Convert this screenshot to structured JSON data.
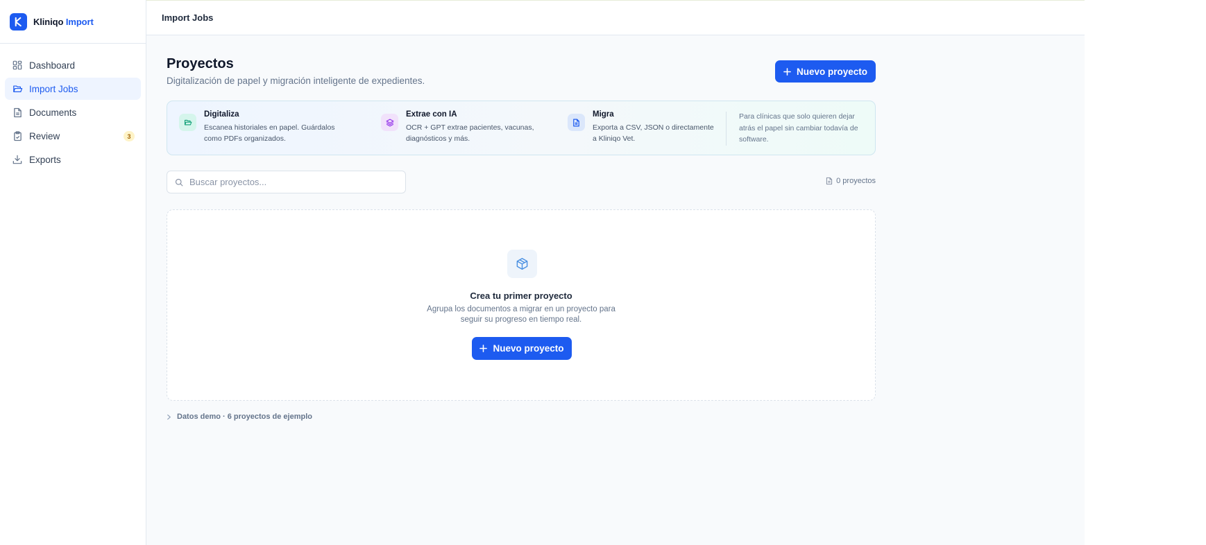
{
  "brand": {
    "name": "Kliniqo",
    "accent": "Import"
  },
  "sidebar": {
    "items": [
      {
        "label": "Dashboard",
        "icon": "dashboard-icon"
      },
      {
        "label": "Import Jobs",
        "icon": "folder-open-icon",
        "active": true
      },
      {
        "label": "Documents",
        "icon": "document-icon"
      },
      {
        "label": "Review",
        "icon": "clipboard-icon",
        "badge": "3"
      },
      {
        "label": "Exports",
        "icon": "download-icon"
      }
    ]
  },
  "topbar": {
    "title": "Import Jobs"
  },
  "header": {
    "title": "Proyectos",
    "subtitle": "Digitalización de papel y migración inteligente de expedientes.",
    "new_project_label": "Nuevo proyecto"
  },
  "features": {
    "items": [
      {
        "title": "Digitaliza",
        "desc": "Escanea historiales en papel. Guárdalos como PDFs organizados.",
        "icon": "folder-open-icon"
      },
      {
        "title": "Extrae con IA",
        "desc": "OCR + GPT extrae pacientes, vacunas, diagnósticos y más.",
        "icon": "layers-icon"
      },
      {
        "title": "Migra",
        "desc": "Exporta a CSV, JSON o directamente a Kliniqo Vet.",
        "icon": "file-text-icon"
      }
    ],
    "note": "Para clínicas que solo quieren dejar atrás el papel sin cambiar todavía de software."
  },
  "search": {
    "placeholder": "Buscar proyectos..."
  },
  "count": {
    "label": "0 proyectos"
  },
  "empty_state": {
    "title": "Crea tu primer proyecto",
    "desc_line1": "Agrupa los documentos a migrar en un proyecto para",
    "desc_line2": "seguir su progreso en tiempo real.",
    "button_label": "Nuevo proyecto"
  },
  "demo": {
    "label": "Datos demo · 6 proyectos de ejemplo"
  },
  "colors": {
    "accent": "#1d5bf0",
    "badge_bg": "#fef3c7",
    "badge_text": "#a16207"
  }
}
